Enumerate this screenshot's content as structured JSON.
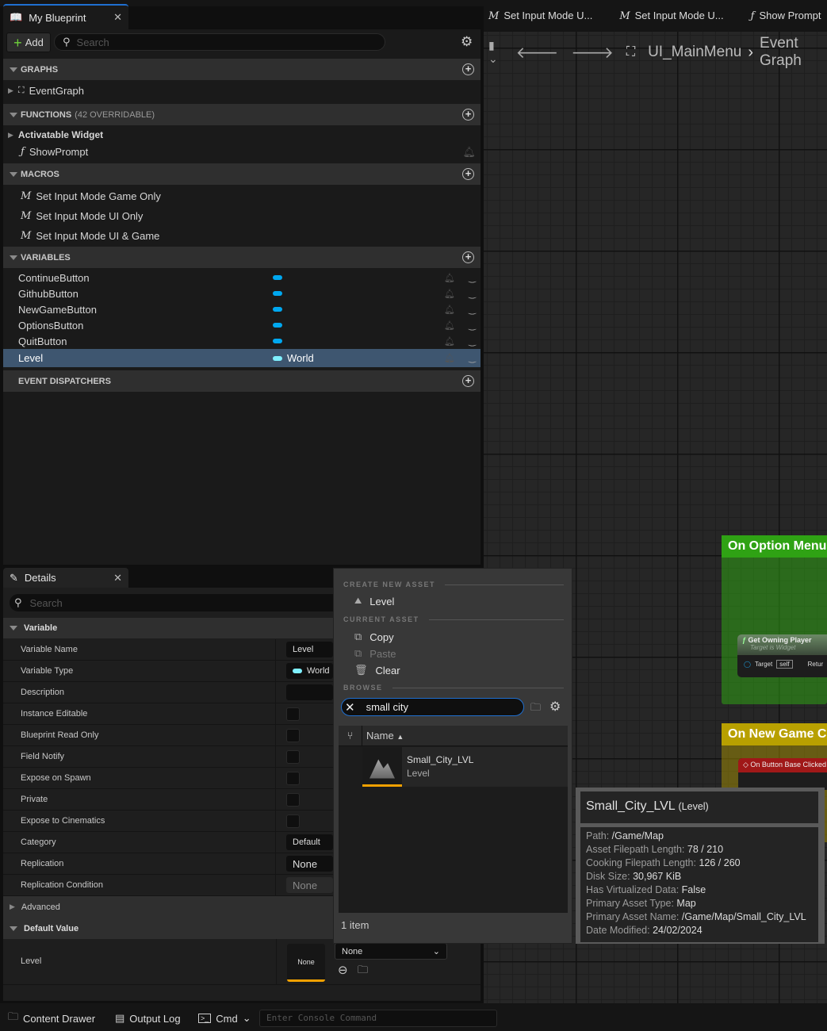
{
  "my_blueprint": {
    "tab_label": "My Blueprint",
    "add_label": "Add",
    "search_placeholder": "Search",
    "graphs": {
      "header": "GRAPHS",
      "items": [
        "EventGraph"
      ]
    },
    "functions": {
      "header": "FUNCTIONS",
      "sub": "(42 OVERRIDABLE)",
      "items": [
        "Activatable Widget",
        "ShowPrompt"
      ]
    },
    "macros": {
      "header": "MACROS",
      "items": [
        "Set Input  Mode Game Only",
        "Set Input Mode UI Only",
        "Set Input Mode UI & Game"
      ]
    },
    "variables": {
      "header": "VARIABLES",
      "items": [
        {
          "name": "ContinueButton",
          "type": ""
        },
        {
          "name": "GithubButton",
          "type": ""
        },
        {
          "name": "NewGameButton",
          "type": ""
        },
        {
          "name": "OptionsButton",
          "type": ""
        },
        {
          "name": "QuitButton",
          "type": ""
        },
        {
          "name": "Level",
          "type": "World",
          "selected": true
        }
      ]
    },
    "event_dispatchers": {
      "header": "EVENT DISPATCHERS"
    }
  },
  "graph": {
    "tabs": [
      {
        "icon": "macro-icon",
        "label": "Set Input Mode U..."
      },
      {
        "icon": "macro-icon",
        "label": "Set Input Mode U..."
      },
      {
        "icon": "function-icon",
        "label": "Show Prompt"
      }
    ],
    "breadcrumb": [
      "UI_MainMenu",
      "Event Graph"
    ],
    "nodes": {
      "option_comment": "On Option Menu C",
      "get_owning_player": "Get Owning Player",
      "get_owning_player_sub": "Target is Widget",
      "target_label": "Target",
      "target_value": "self",
      "return_label": "Retur",
      "new_game_comment": "On New Game Clic",
      "button_clicked": "On Button Base Clicked"
    },
    "colors": {
      "green_comment": "#2fa214",
      "yellow_comment": "#b8a000",
      "event_node": "#a01818"
    }
  },
  "details": {
    "tab_label": "Details",
    "search_placeholder": "Search",
    "variable_header": "Variable",
    "rows": [
      {
        "label": "Variable Name",
        "kind": "text",
        "value": "Level"
      },
      {
        "label": "Variable Type",
        "kind": "type",
        "value": "World"
      },
      {
        "label": "Description",
        "kind": "text",
        "value": ""
      },
      {
        "label": "Instance Editable",
        "kind": "check",
        "value": false
      },
      {
        "label": "Blueprint Read Only",
        "kind": "check",
        "value": false
      },
      {
        "label": "Field Notify",
        "kind": "check",
        "value": false
      },
      {
        "label": "Expose on Spawn",
        "kind": "check",
        "value": false
      },
      {
        "label": "Private",
        "kind": "check",
        "value": false
      },
      {
        "label": "Expose to Cinematics",
        "kind": "check",
        "value": false
      },
      {
        "label": "Category",
        "kind": "text",
        "value": "Default"
      },
      {
        "label": "Replication",
        "kind": "text",
        "value": "None"
      },
      {
        "label": "Replication Condition",
        "kind": "text",
        "value": "None"
      }
    ],
    "advanced_header": "Advanced",
    "default_header": "Default Value",
    "default_label": "Level",
    "default_thumb": "None",
    "default_combo": "None"
  },
  "asset_picker": {
    "create_header": "CREATE NEW ASSET",
    "create_items": [
      "Level"
    ],
    "current_header": "CURRENT ASSET",
    "copy": "Copy",
    "paste": "Paste",
    "clear": "Clear",
    "browse_header": "BROWSE",
    "search_value": "small city",
    "column_name": "Name",
    "results": [
      {
        "name": "Small_City_LVL",
        "type": "Level"
      }
    ],
    "count": "1 item"
  },
  "tooltip": {
    "title": "Small_City_LVL",
    "title_type": "(Level)",
    "lines": [
      {
        "k": "Path:",
        "v": "/Game/Map"
      },
      {
        "k": "Asset Filepath Length:",
        "v": "78 / 210"
      },
      {
        "k": "Cooking Filepath Length:",
        "v": "126 / 260"
      },
      {
        "k": "Disk Size:",
        "v": "30,967 KiB"
      },
      {
        "k": "Has Virtualized Data:",
        "v": "False"
      },
      {
        "k": "Primary Asset Type:",
        "v": "Map"
      },
      {
        "k": "Primary Asset Name:",
        "v": "/Game/Map/Small_City_LVL"
      },
      {
        "k": "Date Modified:",
        "v": "24/02/2024"
      }
    ]
  },
  "bottom_bar": {
    "content_drawer": "Content Drawer",
    "output_log": "Output Log",
    "cmd": "Cmd",
    "console_placeholder": "Enter Console Command"
  }
}
